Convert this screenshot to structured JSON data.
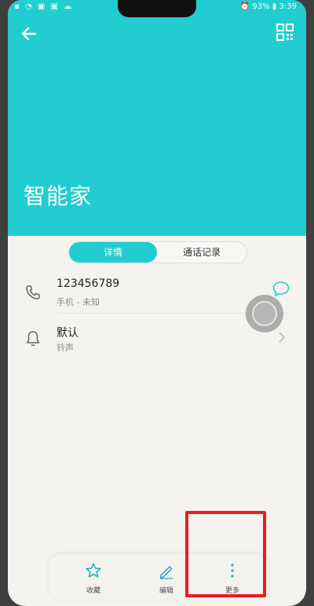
{
  "status_bar": {
    "battery": "93%",
    "time": "3:39"
  },
  "header": {
    "contact_name": "智能家"
  },
  "tabs": [
    {
      "label": "详情",
      "active": true
    },
    {
      "label": "通话记录",
      "active": false
    }
  ],
  "details": {
    "phone_number": "123456789",
    "phone_type": "手机 - 未知",
    "ringtone_value": "默认",
    "ringtone_label": "铃声"
  },
  "bottom_bar": [
    {
      "label": "收藏",
      "icon": "star-icon"
    },
    {
      "label": "编辑",
      "icon": "pencil-icon"
    },
    {
      "label": "更多",
      "icon": "more-vertical-icon"
    }
  ],
  "colors": {
    "accent": "#22cdd1",
    "highlight": "#ee1c1c"
  }
}
